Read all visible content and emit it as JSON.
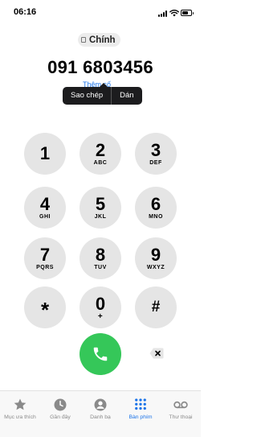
{
  "status_bar": {
    "time": "06:16"
  },
  "sim": {
    "label": "Chính"
  },
  "dialed_number": "091 6803456",
  "add_number_hint": "Thêm số",
  "popover": {
    "copy": "Sao chép",
    "paste": "Dán"
  },
  "keypad": [
    {
      "digit": "1",
      "letters": ""
    },
    {
      "digit": "2",
      "letters": "ABC"
    },
    {
      "digit": "3",
      "letters": "DEF"
    },
    {
      "digit": "4",
      "letters": "GHI"
    },
    {
      "digit": "5",
      "letters": "JKL"
    },
    {
      "digit": "6",
      "letters": "MNO"
    },
    {
      "digit": "7",
      "letters": "PQRS"
    },
    {
      "digit": "8",
      "letters": "TUV"
    },
    {
      "digit": "9",
      "letters": "WXYZ"
    },
    {
      "digit": "*",
      "letters": ""
    },
    {
      "digit": "0",
      "letters": "+"
    },
    {
      "digit": "#",
      "letters": ""
    }
  ],
  "tabs": [
    {
      "label": "Mục ưa thích",
      "icon": "star-icon"
    },
    {
      "label": "Gần đây",
      "icon": "clock-icon"
    },
    {
      "label": "Danh bạ",
      "icon": "person-icon"
    },
    {
      "label": "Bàn phím",
      "icon": "keypad-icon",
      "active": true
    },
    {
      "label": "Thư thoại",
      "icon": "voicemail-icon"
    }
  ],
  "colors": {
    "accent": "#1a73e8",
    "call": "#35c759",
    "key": "#e5e5e5",
    "popover": "#1c1c1e"
  }
}
